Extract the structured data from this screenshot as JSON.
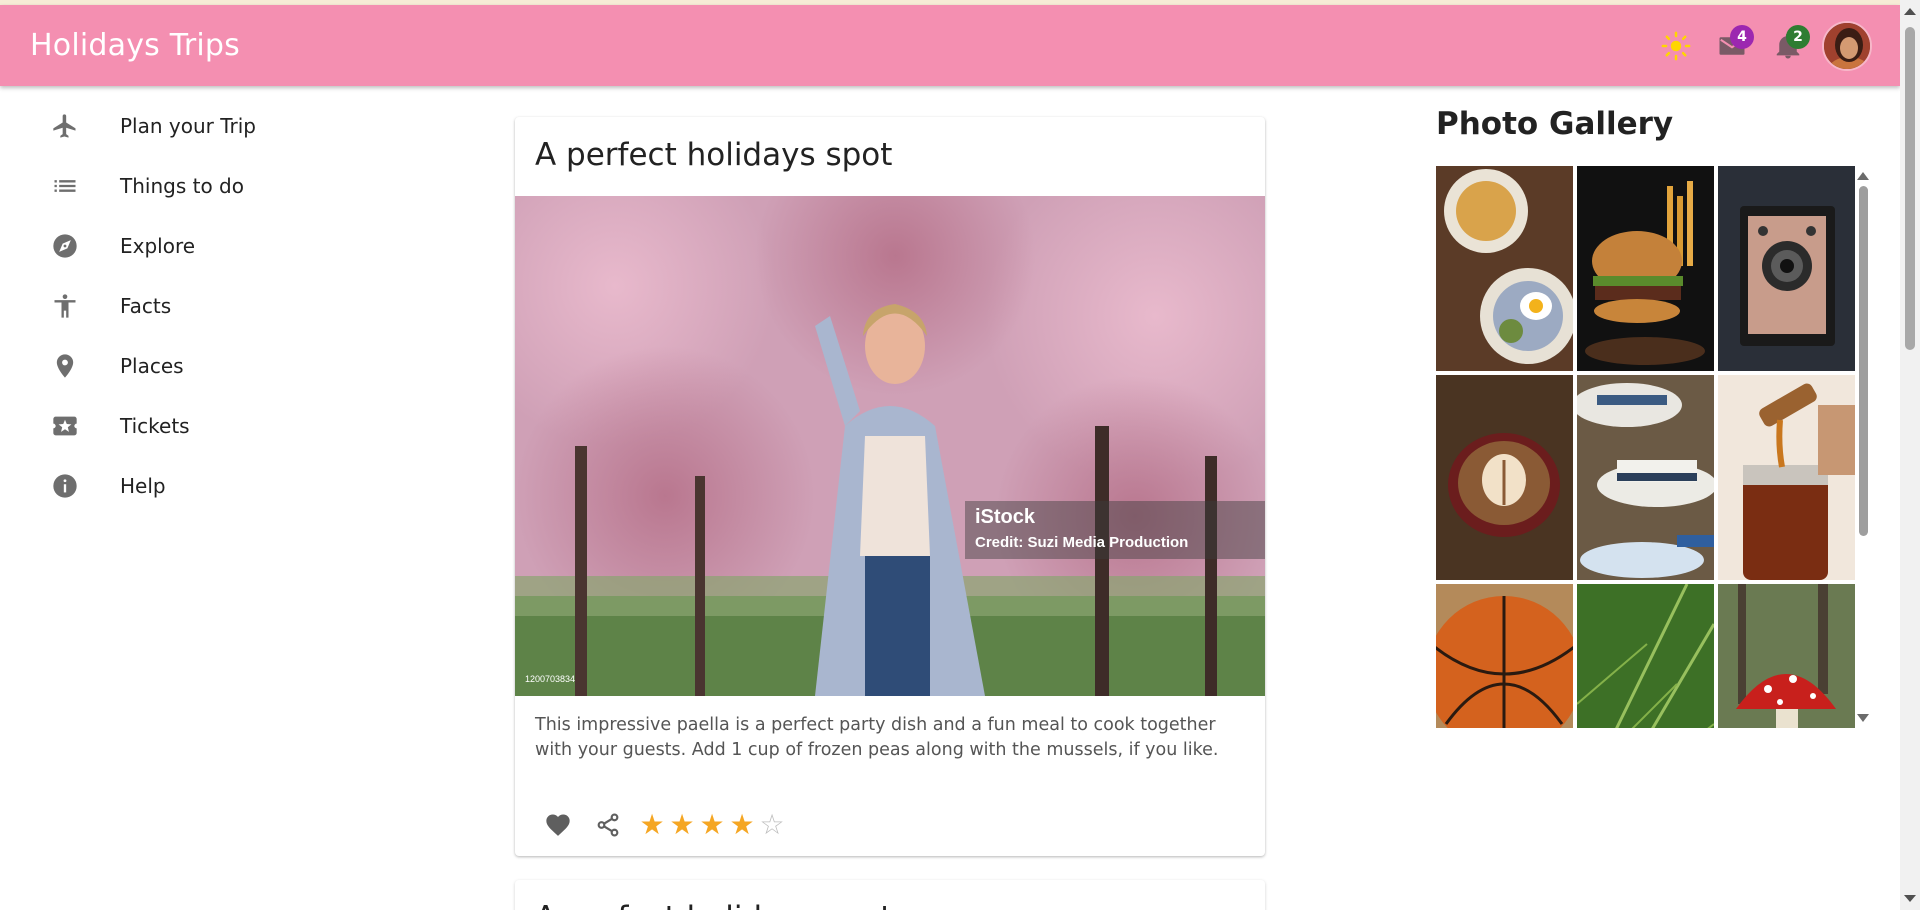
{
  "app": {
    "title": "Holidays Trips"
  },
  "header": {
    "theme_icon": "sun-icon",
    "mail_badge": "4",
    "notifications_badge": "2",
    "colors": {
      "bar": "#f48fb1",
      "sun": "#ffd600",
      "mail_badge": "#9c27b0",
      "notif_badge": "#2e7d32"
    }
  },
  "sidebar": {
    "items": [
      {
        "label": "Plan your Trip",
        "icon": "airplane-icon"
      },
      {
        "label": "Things to do",
        "icon": "list-icon"
      },
      {
        "label": "Explore",
        "icon": "compass-icon"
      },
      {
        "label": "Facts",
        "icon": "accessibility-icon"
      },
      {
        "label": "Places",
        "icon": "place-icon"
      },
      {
        "label": "Tickets",
        "icon": "ticket-icon"
      },
      {
        "label": "Help",
        "icon": "info-icon"
      }
    ]
  },
  "card": {
    "title": "A perfect holidays spot",
    "watermark_brand": "iStock",
    "watermark_credit": "Credit: Suzi Media Production",
    "image_id": "1200703834",
    "description": "This impressive paella is a perfect party dish and a fun meal to cook together with your guests. Add 1 cup of frozen peas along with the mussels, if you like.",
    "rating": 4,
    "rating_max": 5
  },
  "card2": {
    "title": "A perfect holidays spot"
  },
  "gallery": {
    "title": "Photo Gallery",
    "photos": [
      "breakfast-icon",
      "burger-icon",
      "camera-icon",
      "coffee-icon",
      "hats-icon",
      "honey-icon",
      "basketball-icon",
      "fern-icon",
      "mushroom-icon"
    ]
  }
}
